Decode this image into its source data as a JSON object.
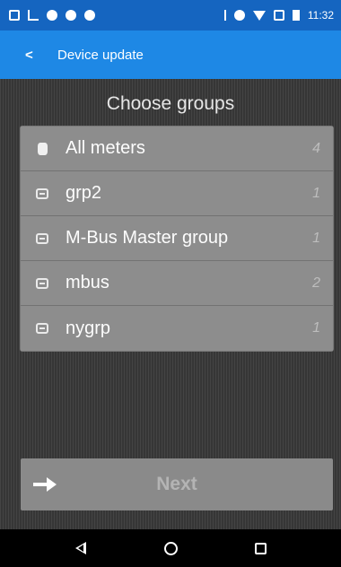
{
  "status_bar": {
    "time": "11:32",
    "left_icons": [
      "notification-icon",
      "usb-icon",
      "location-icon",
      "photo-icon",
      "photo-icon"
    ],
    "right_icons": [
      "bluetooth-icon",
      "vibrate-icon",
      "wifi-icon",
      "no-sim-icon",
      "battery-icon"
    ]
  },
  "app_bar": {
    "back_label": "<",
    "title": "Device update"
  },
  "main": {
    "heading": "Choose groups",
    "groups": [
      {
        "name": "All meters",
        "count": "4",
        "icon": "database-icon"
      },
      {
        "name": "grp2",
        "count": "1",
        "icon": "group-icon"
      },
      {
        "name": "M-Bus Master group",
        "count": "1",
        "icon": "group-icon"
      },
      {
        "name": "mbus",
        "count": "2",
        "icon": "group-icon"
      },
      {
        "name": "nygrp",
        "count": "1",
        "icon": "group-icon"
      }
    ],
    "next_label": "Next"
  },
  "nav_bar": {
    "icons": [
      "back-icon",
      "home-icon",
      "recents-icon"
    ]
  },
  "colors": {
    "status_bar": "#1565c0",
    "app_bar": "#1e88e5",
    "list_background": "#8d8d8d",
    "content_background": "#3d3d3d"
  }
}
